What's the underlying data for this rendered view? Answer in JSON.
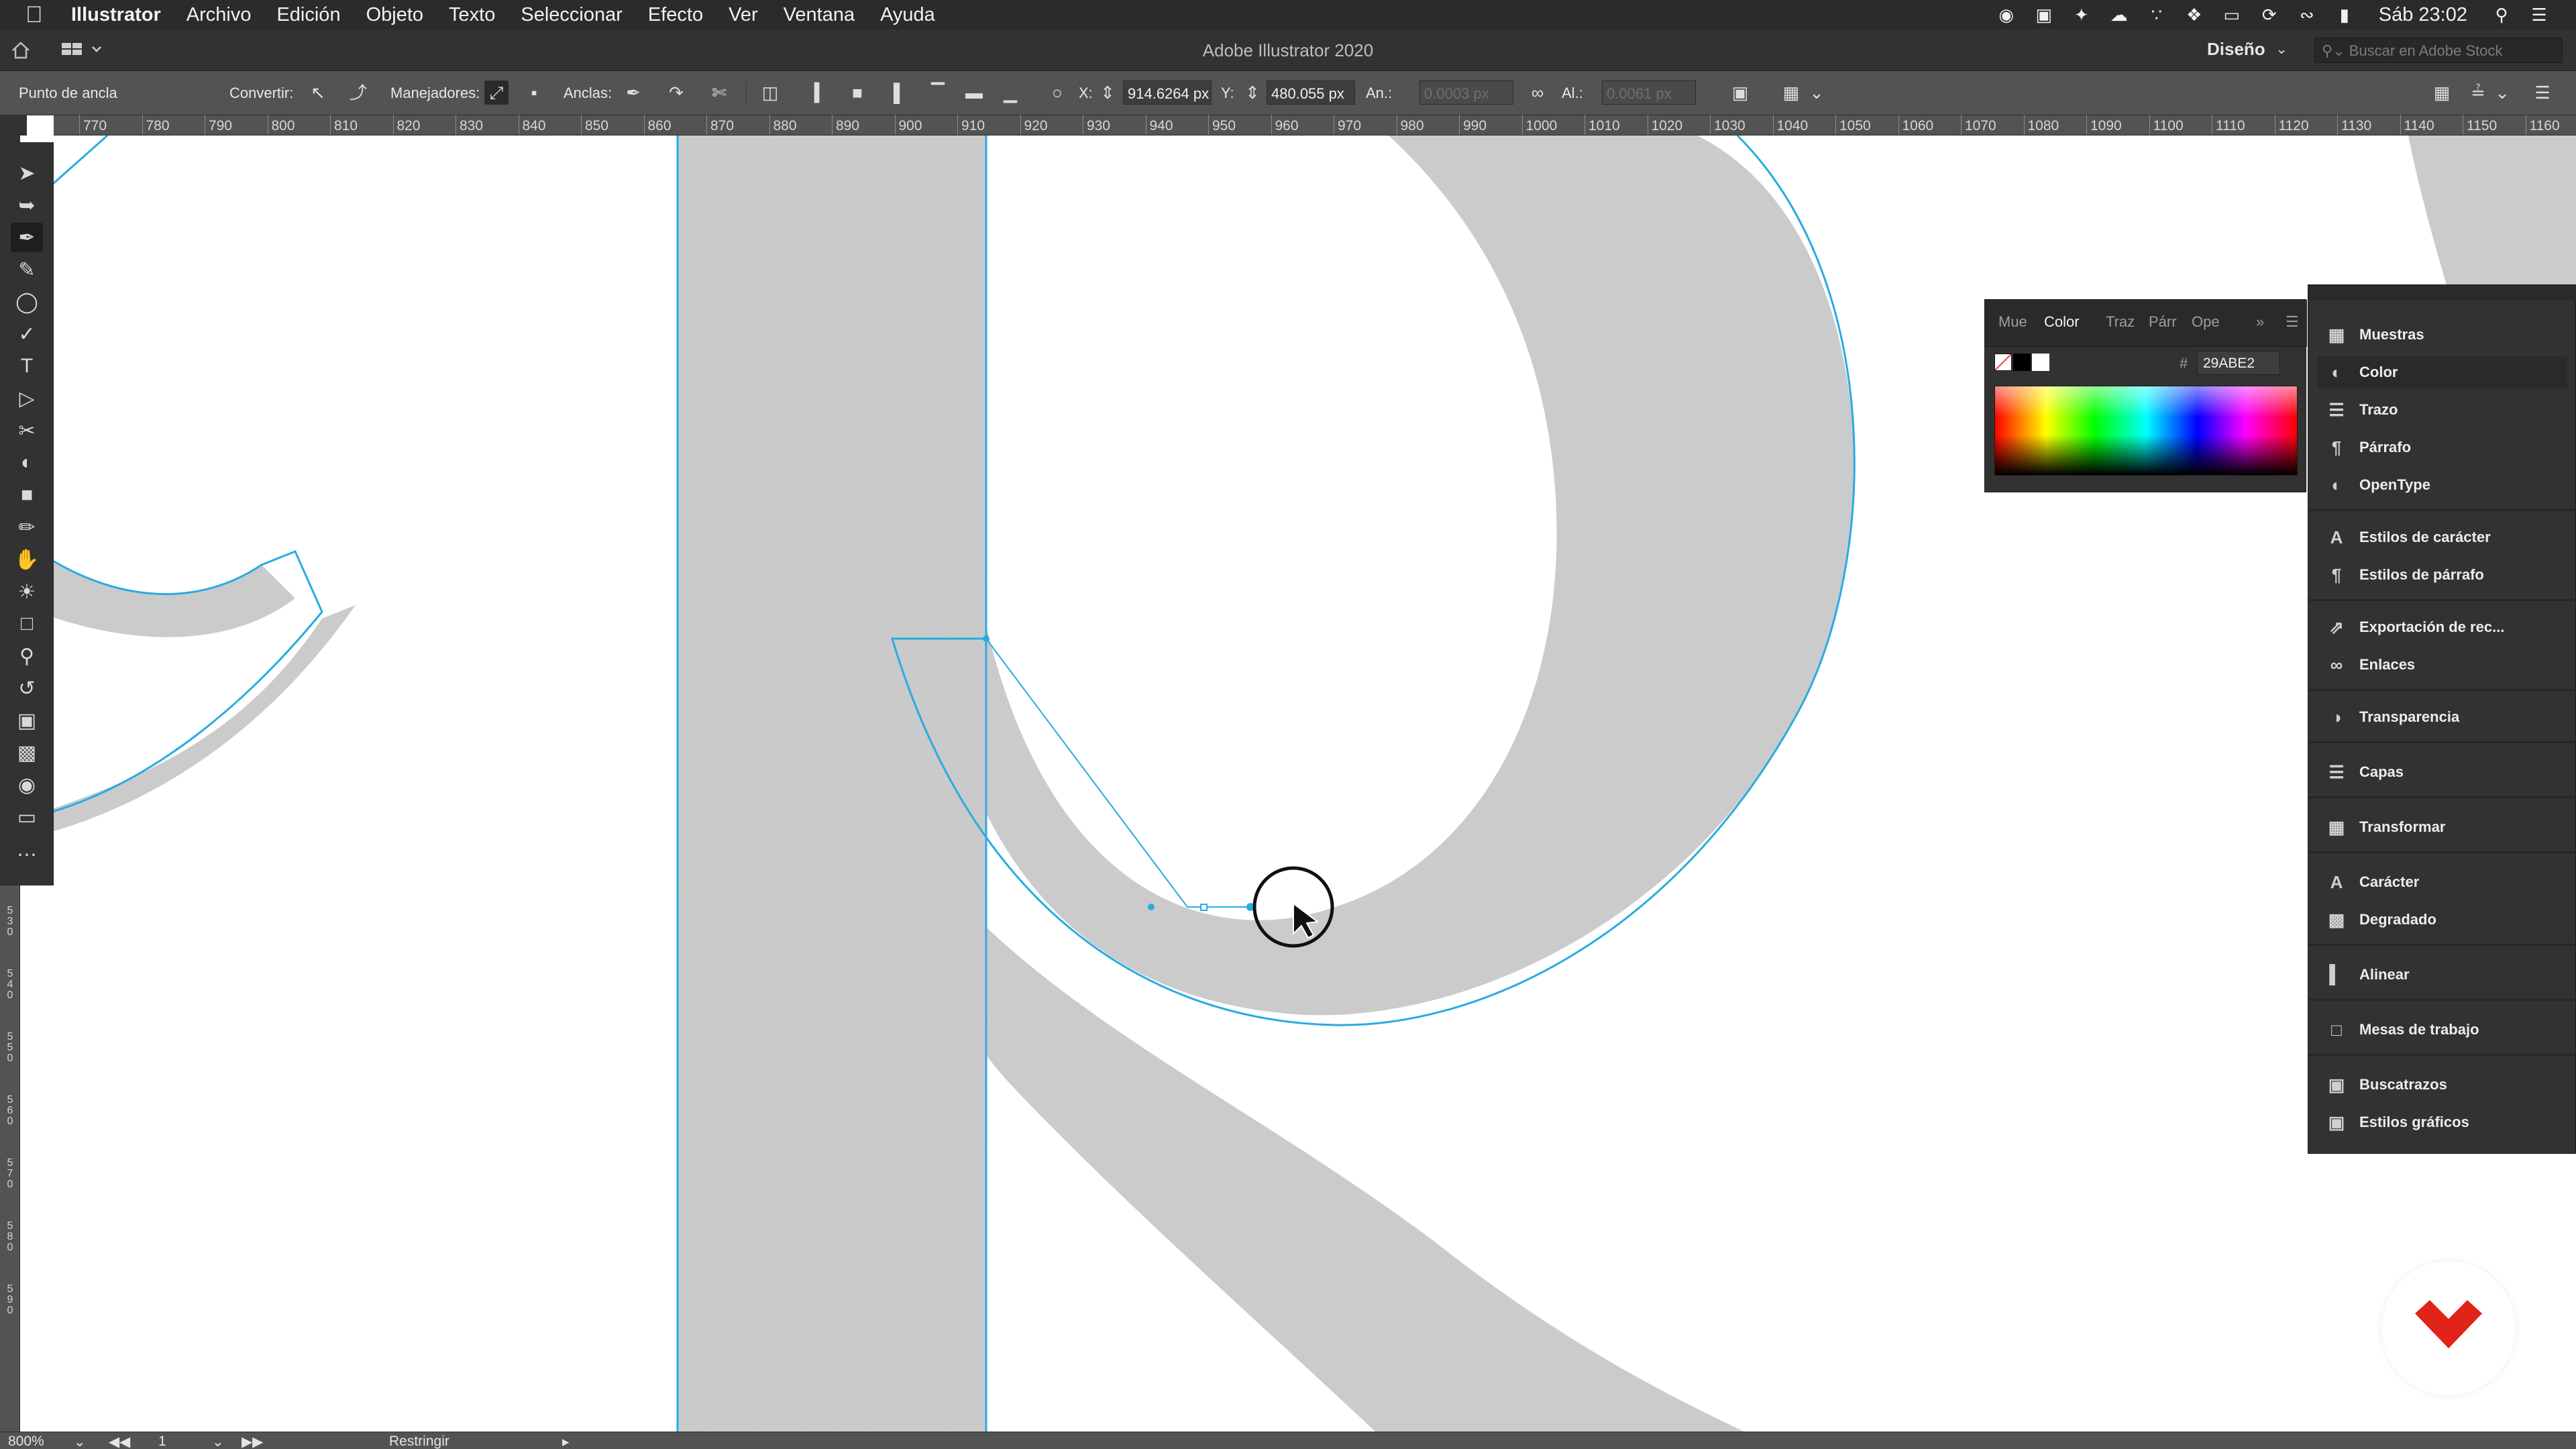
{
  "menubar": {
    "app_name": "Illustrator",
    "items": [
      "Archivo",
      "Edición",
      "Objeto",
      "Texto",
      "Seleccionar",
      "Efecto",
      "Ver",
      "Ventana",
      "Ayuda"
    ],
    "status_icons": [
      "record-icon",
      "screen-share-icon",
      "magic-icon",
      "creative-cloud-icon",
      "bluetooth-icon",
      "dropbox-icon",
      "airplay-icon",
      "sync-icon",
      "wifi-icon",
      "battery-icon"
    ],
    "clock": "Sáb 23:02"
  },
  "titlebar": {
    "title": "Adobe Illustrator 2020",
    "workspace": "Diseño",
    "search_placeholder": "Buscar en Adobe Stock"
  },
  "controlbar": {
    "anchor_label": "Punto de ancla",
    "convert_label": "Convertir:",
    "handles_label": "Manejadores:",
    "anchors_label": "Anclas:",
    "x_label": "X:",
    "x_value": "914.6264 px",
    "y_label": "Y:",
    "y_value": "480.055 px",
    "w_label": "An.:",
    "w_value": "0.0003 px",
    "h_label": "Al.:",
    "h_value": "0.0061 px"
  },
  "ruler_top": [
    "770",
    "780",
    "790",
    "800",
    "810",
    "820",
    "830",
    "840",
    "850",
    "860",
    "870",
    "880",
    "890",
    "900",
    "910",
    "920",
    "930",
    "940",
    "950",
    "960",
    "970",
    "980",
    "990",
    "1000",
    "1010",
    "1020",
    "1030",
    "1040",
    "1050",
    "1060",
    "1070",
    "1080",
    "1090",
    "1100",
    "1110",
    "1120",
    "1130",
    "1140",
    "1150",
    "1160"
  ],
  "ruler_left": [
    "5\n3\n0",
    "5\n4\n0",
    "5\n5\n0",
    "5\n6\n0",
    "5\n7\n0",
    "5\n8\n0",
    "5\n9\n0"
  ],
  "color_panel": {
    "tabs": [
      "Mue",
      "Color",
      "Traz",
      "Párr",
      "Ope"
    ],
    "active_tab": "Color",
    "hex_label": "#",
    "hex_value": "29ABE2"
  },
  "dock": {
    "items": [
      "Muestras",
      "Color",
      "Trazo",
      "Párrafo",
      "OpenType",
      "Estilos de carácter",
      "Estilos de párrafo",
      "Exportación de rec...",
      "Enlaces",
      "Transparencia",
      "Capas",
      "Transformar",
      "Carácter",
      "Degradado",
      "Alinear",
      "Mesas de trabajo",
      "Buscatrazos",
      "Estilos gráficos"
    ],
    "active": "Color"
  },
  "statusbar": {
    "zoom": "800%",
    "artboard": "1",
    "mode": "Restringir"
  },
  "colors": {
    "selection": "#29ABE2",
    "ui_dark": "#323232",
    "ui_mid": "#535353",
    "brand_red": "#e2231a"
  }
}
